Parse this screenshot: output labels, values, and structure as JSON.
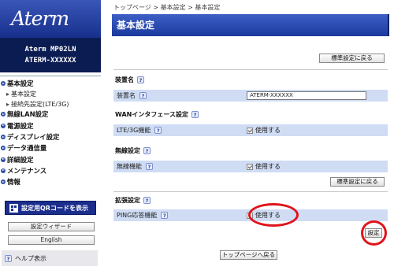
{
  "sidebar": {
    "logo": "Aterm",
    "model_line1": "Aterm  MP02LN",
    "model_line2": "ATERM-XXXXXX",
    "nav": [
      {
        "label": "基本設定",
        "sub": [
          "基本設定",
          "接続先設定(LTE/3G)"
        ]
      },
      {
        "label": "無線LAN設定"
      },
      {
        "label": "電源設定"
      },
      {
        "label": "ディスプレイ設定"
      },
      {
        "label": "データ通信量"
      },
      {
        "label": "詳細設定"
      },
      {
        "label": "メンテナンス"
      },
      {
        "label": "情報"
      }
    ],
    "qr_button": "設定用QRコードを表示",
    "wizard_button": "設定ウィザード",
    "english_button": "English",
    "help_label": "ヘルプ表示"
  },
  "breadcrumb": "トップページ > 基本設定 > 基本設定",
  "page_title": "基本設定",
  "buttons": {
    "reset_top": "標準設定に戻る",
    "reset_bottom": "標準設定に戻る",
    "apply": "設定",
    "back_top": "トップページへ戻る"
  },
  "sections": {
    "device_name": {
      "title": "装置名",
      "label": "装置名",
      "value": "ATERM-XXXXXX"
    },
    "wan": {
      "title": "WANインタフェース設定",
      "label": "LTE/3G機能",
      "checkbox_label": "使用する",
      "checked": true
    },
    "wireless": {
      "title": "無線設定",
      "label": "無線機能",
      "checkbox_label": "使用する",
      "checked": true
    },
    "extended": {
      "title": "拡張設定",
      "label": "PING応答機能",
      "checkbox_label": "使用する",
      "checked": false
    }
  },
  "help_mark": "?",
  "colors": {
    "accent": "#1b3a9e",
    "row_bg": "#cfdcf4",
    "highlight": "#e0141c"
  }
}
